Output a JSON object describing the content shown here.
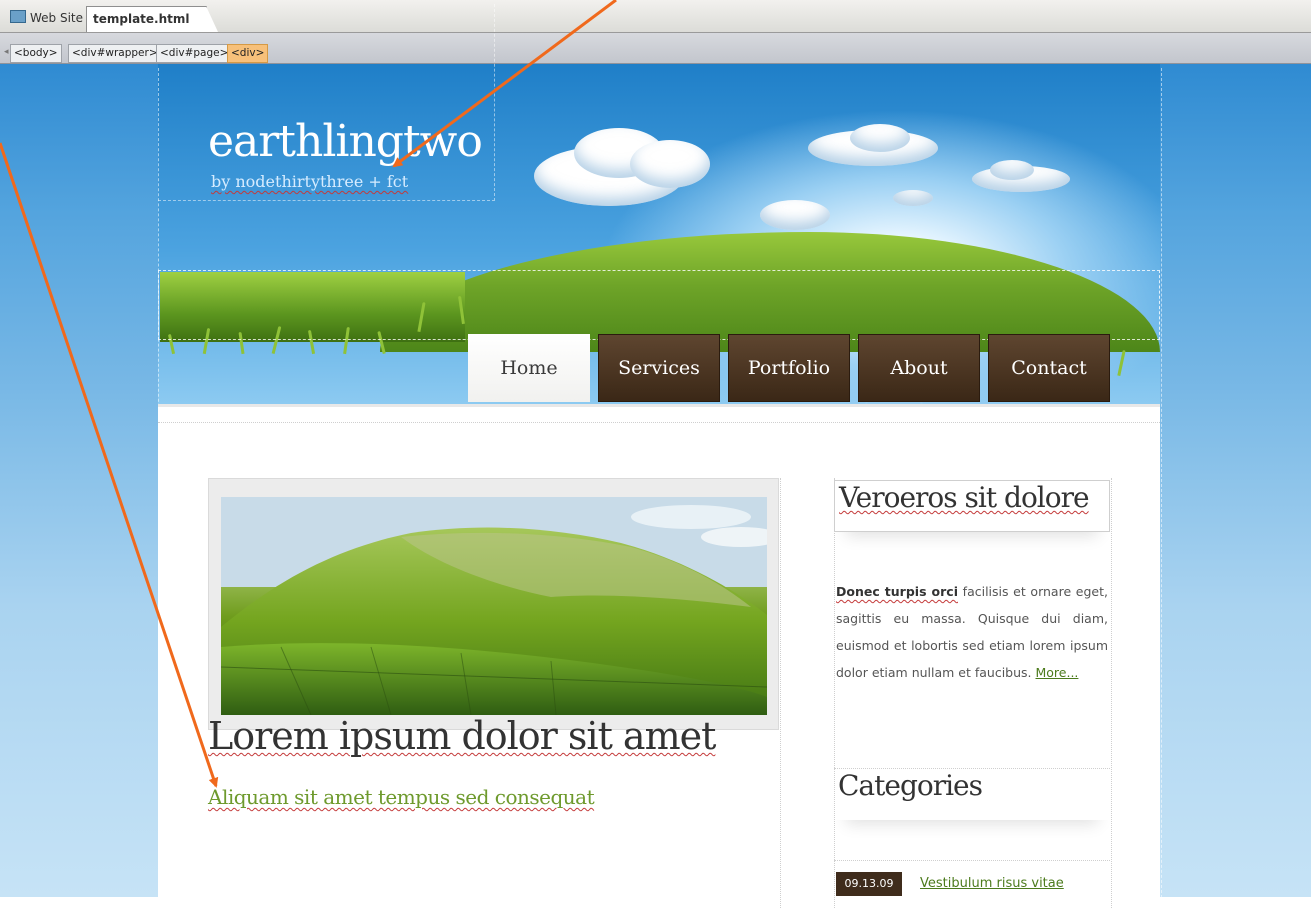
{
  "tabs": {
    "site_label": "Web Site",
    "file_label": "template.html"
  },
  "tag_selector": [
    "<body>",
    "<div#wrapper>",
    "<div#page>",
    "<div>"
  ],
  "site": {
    "title": "earthlingtwo",
    "subtitle": "by nodethirtythree + fct"
  },
  "nav": [
    "Home",
    "Services",
    "Portfolio",
    "About",
    "Contact"
  ],
  "main": {
    "post_title": "Lorem ipsum dolor sit amet",
    "post_subtitle": "Aliquam sit amet tempus sed consequat"
  },
  "sidebar": {
    "heading_1": "Veroeros sit dolore",
    "text_bold": "Donec turpis orci",
    "text_body": " facilisis et ornare eget, sagittis eu massa. Quisque dui diam, euismod et lobortis sed etiam lorem ipsum dolor etiam nullam et faucibus. ",
    "more_link": "More...",
    "heading_2": "Categories",
    "date": "09.13.09",
    "category_link": "Vestibulum risus vitae"
  },
  "colors": {
    "arrow": "#f0691c",
    "nav_brown": "#4a3420",
    "accent_green": "#6e9a2d"
  }
}
